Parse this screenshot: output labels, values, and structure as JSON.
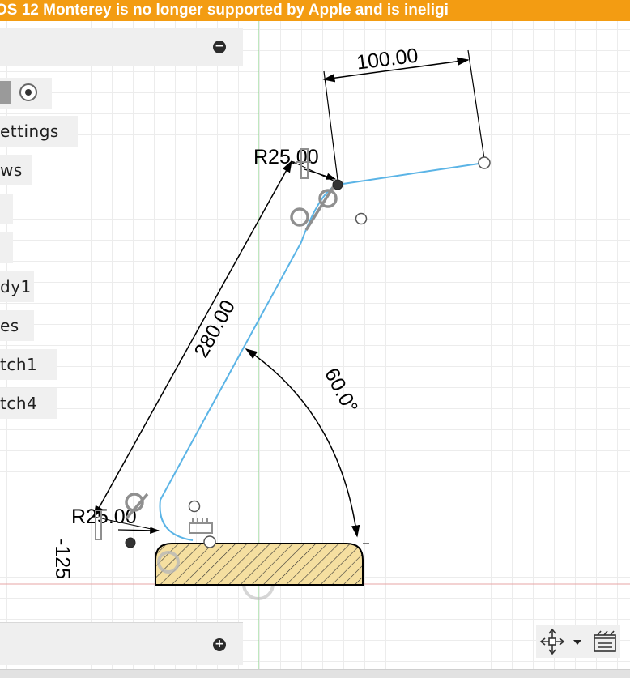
{
  "banner": {
    "text": "OS 12 Monterey is no longer supported by Apple and is ineligi"
  },
  "browser": {
    "collapse_icon": "minus-circle-icon",
    "items": [
      {
        "id": "named-views",
        "label": "ettings"
      },
      {
        "id": "views",
        "label": "ws"
      },
      {
        "id": "item-3",
        "label": ""
      },
      {
        "id": "item-4",
        "label": ""
      },
      {
        "id": "body1",
        "label": "dy1"
      },
      {
        "id": "sketches",
        "label": "es"
      },
      {
        "id": "sketch1",
        "label": "tch1"
      },
      {
        "id": "sketch4",
        "label": "tch4"
      }
    ]
  },
  "comments_bar": {
    "expand_icon": "plus-circle-icon"
  },
  "sketch": {
    "dims": {
      "horizontal_length": "100.00",
      "arm_length": "280.00",
      "angle": "60.0°",
      "radius_top": "R25.00",
      "radius_bottom": "R25.00",
      "offset": "-125"
    }
  },
  "nav_tools": {
    "orbit_icon": "orbit-icon",
    "dropdown_icon": "chevron-down-icon",
    "display_icon": "display-settings-icon"
  },
  "colors": {
    "banner": "#f39c12",
    "sketch_line": "#5bb4e6",
    "x_axis": "#e7a5a5",
    "y_axis": "#7fd07f",
    "profile_fill": "#f5dfa0"
  }
}
